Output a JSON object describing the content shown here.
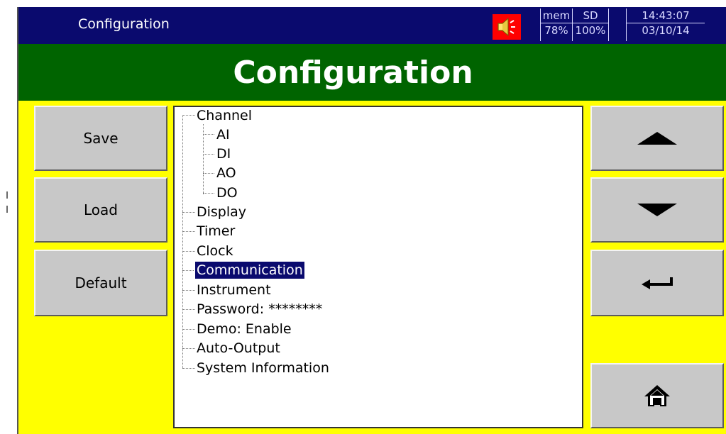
{
  "topbar": {
    "title": "Configuration",
    "mem_label": "mem",
    "mem_value": "78%",
    "sd_label": "SD",
    "sd_value": "100%",
    "time": "14:43:07",
    "date": "03/10/14"
  },
  "header": {
    "title": "Configuration"
  },
  "left_buttons": {
    "save": "Save",
    "load": "Load",
    "default": "Default"
  },
  "tree": {
    "channel": "Channel",
    "ai": "AI",
    "di": "DI",
    "ao": "AO",
    "do": "DO",
    "display": "Display",
    "timer": "Timer",
    "clock": "Clock",
    "communication": "Communication",
    "instrument": "Instrument",
    "password": "Password: ********",
    "demo": "Demo: Enable",
    "auto_output": "Auto-Output",
    "system_information": "System Information",
    "selected": "Communication"
  },
  "right_buttons": {
    "up": "up-arrow-icon",
    "down": "down-arrow-icon",
    "enter": "enter-return-icon",
    "home": "home-icon"
  },
  "colors": {
    "topbar": "#0a0a6e",
    "header": "#006400",
    "background": "#ffff00",
    "button": "#c8c8c8",
    "selection": "#0a0a6e"
  }
}
